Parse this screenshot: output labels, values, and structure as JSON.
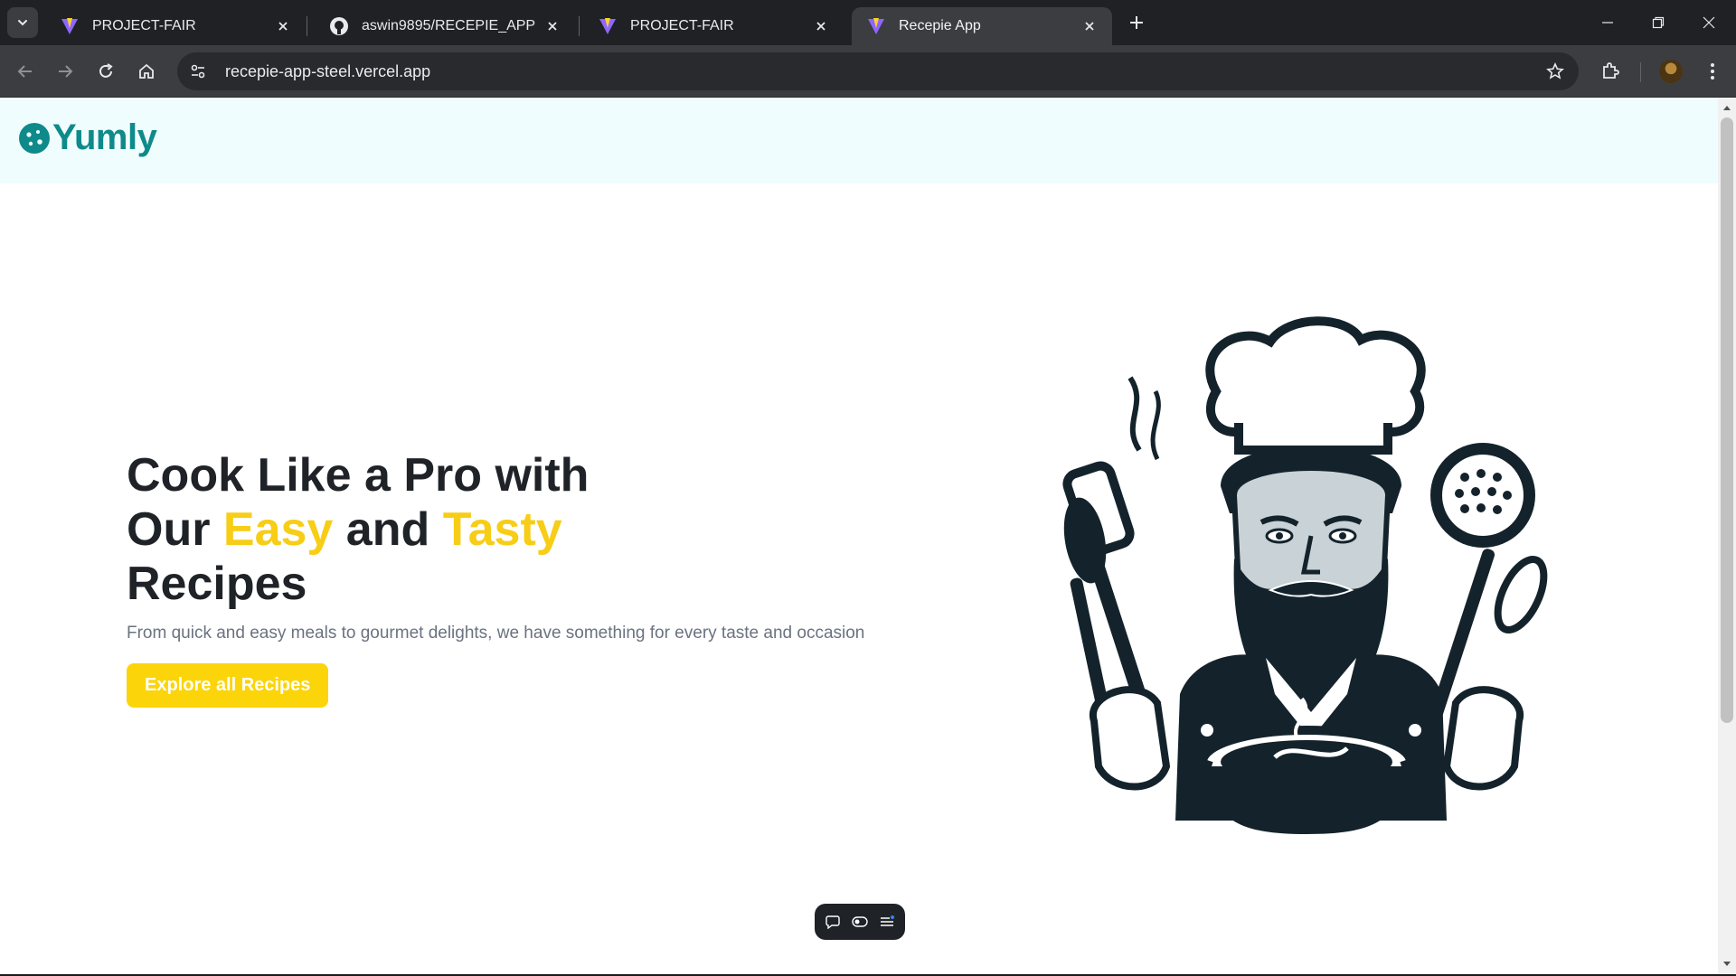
{
  "browser": {
    "tabs": [
      {
        "title": "PROJECT-FAIR",
        "favicon": "vite-icon",
        "active": false
      },
      {
        "title": "aswin9895/RECEPIE_APP",
        "favicon": "github-icon",
        "active": false
      },
      {
        "title": "PROJECT-FAIR",
        "favicon": "vite-icon",
        "active": false
      },
      {
        "title": "Recepie App",
        "favicon": "vite-icon",
        "active": true
      }
    ],
    "url": "recepie-app-steel.vercel.app",
    "colors": {
      "chrome_dark": "#202124",
      "toolbar": "#3c3d41",
      "omnibox": "#282a2d"
    }
  },
  "site": {
    "brand": "Yumly",
    "brand_color": "#0f8a8a",
    "hero": {
      "line1": "Cook Like a Pro with",
      "line2_prefix": "Our ",
      "highlight1": "Easy",
      "line2_mid": " and ",
      "highlight2": "Tasty",
      "line3": "Recipes",
      "subtitle": "From quick and easy meals to gourmet delights, we have something for every taste and occasion",
      "cta_label": "Explore all Recipes",
      "highlight_color": "#f7cd16",
      "cta_color": "#fcd40a"
    },
    "illustration": "chef-illustration"
  },
  "floating_toolbar": {
    "icons": [
      "comment-icon",
      "toggle-icon",
      "menu-icon"
    ]
  }
}
